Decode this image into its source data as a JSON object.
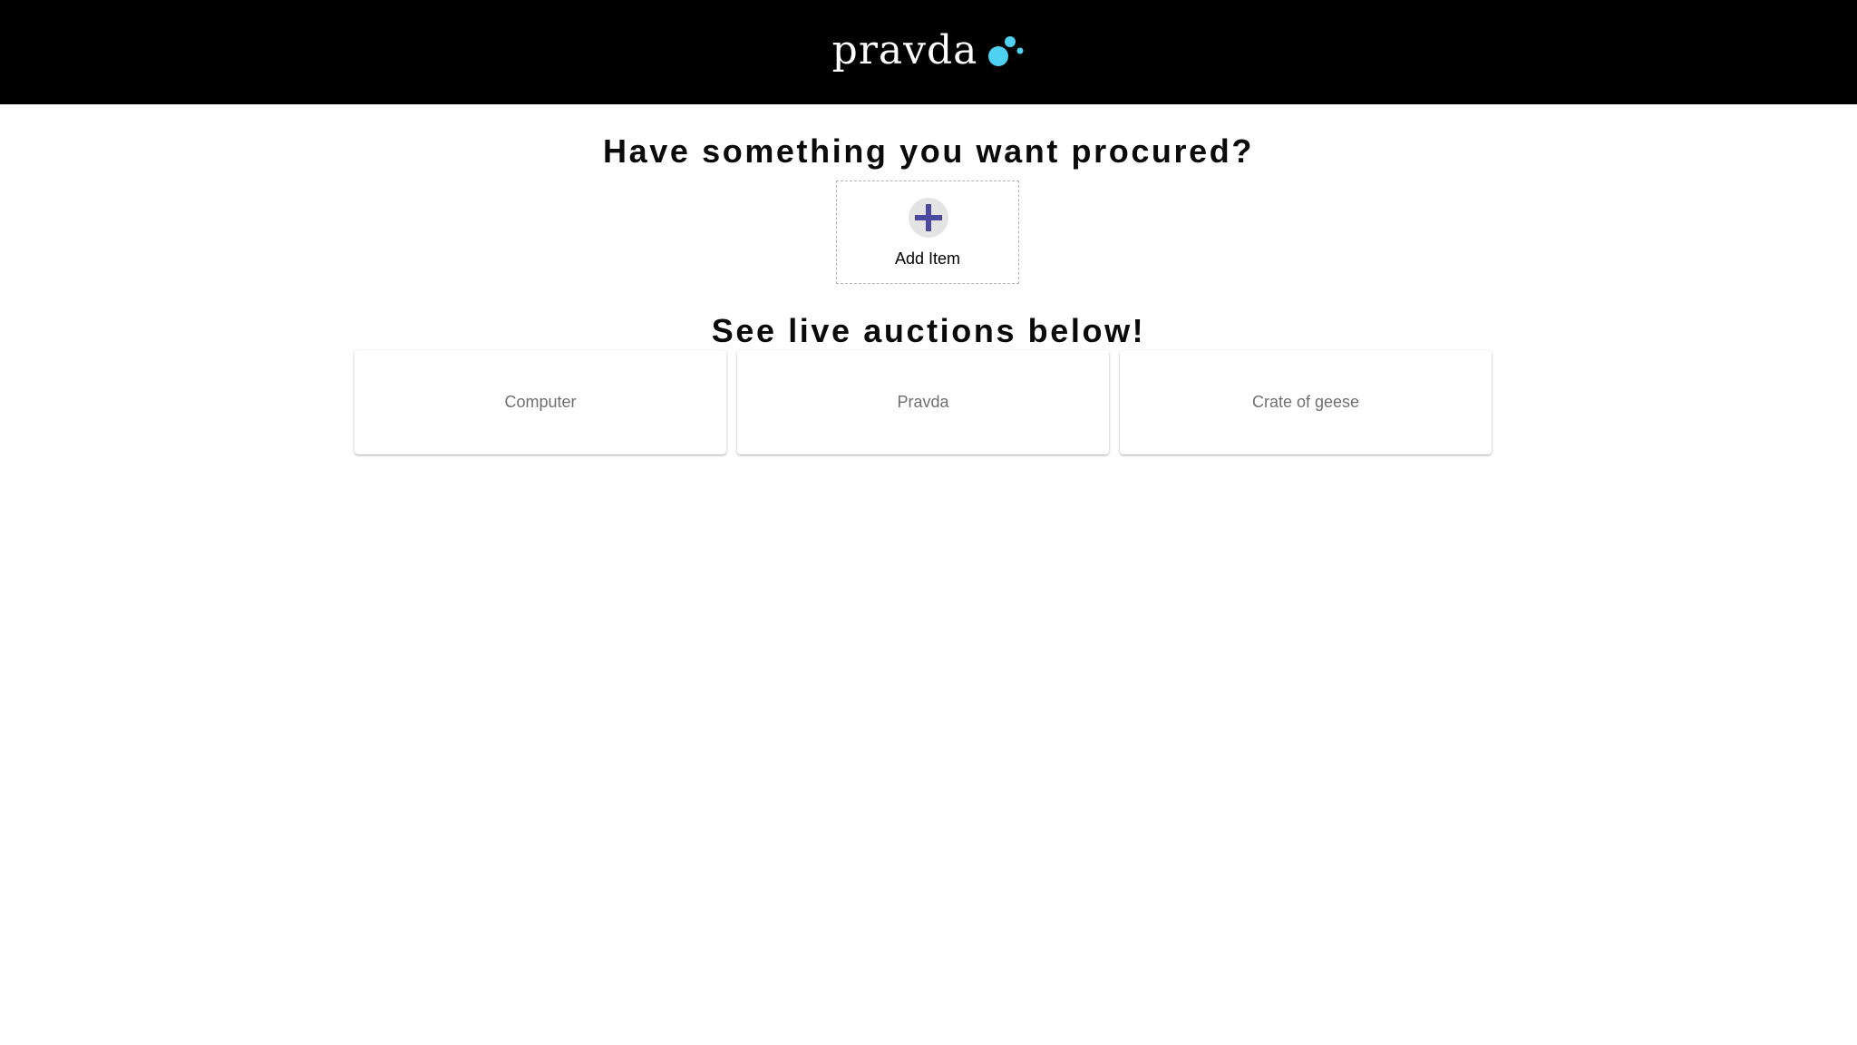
{
  "header": {
    "logo_text": "pravda",
    "logo_icon": "bubbles-icon",
    "background": "#000000",
    "accent": "#4fd1f2"
  },
  "main": {
    "heading_procure": "Have something you want procured?",
    "add_item": {
      "label": "Add Item",
      "icon": "plus-icon",
      "icon_color": "#4a4aa0"
    },
    "heading_auctions": "See live auctions below!",
    "auctions": [
      {
        "label": "Computer"
      },
      {
        "label": "Pravda"
      },
      {
        "label": "Crate of geese"
      }
    ]
  }
}
